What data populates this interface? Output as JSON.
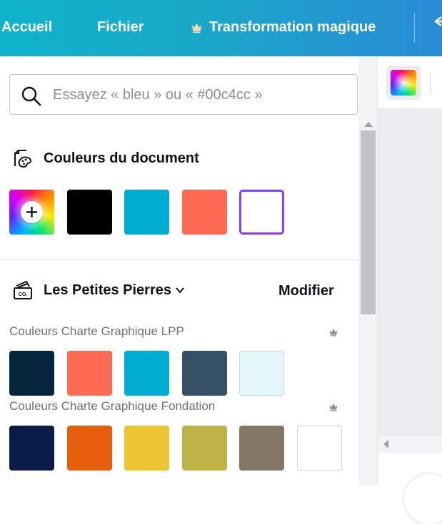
{
  "header": {
    "nav": [
      {
        "label": "Accueil"
      },
      {
        "label": "Fichier"
      },
      {
        "label": "Transformation magique",
        "icon": "crown-icon"
      }
    ],
    "back_icon": "arrow-left-icon"
  },
  "search": {
    "placeholder": "Essayez « bleu » ou « #00c4cc »",
    "value": ""
  },
  "document_colors": {
    "title": "Couleurs du document",
    "icon": "palette-document-icon",
    "swatches": [
      {
        "type": "add-color",
        "icon": "plus-icon"
      },
      {
        "color": "#000000"
      },
      {
        "color": "#00acd1"
      },
      {
        "color": "#ff6a55"
      },
      {
        "color": "#ffffff",
        "selected": true
      }
    ]
  },
  "brand": {
    "name": "Les Petites Pierres",
    "icon": "brand-kit-icon",
    "edit_label": "Modifier",
    "palettes": [
      {
        "label": "Couleurs Charte Graphique LPP",
        "colors": [
          "#05253d",
          "#ff6a55",
          "#00acd1",
          "#365065",
          "#e3f6fa"
        ]
      },
      {
        "label": "Couleurs Charte Graphique Fondation",
        "colors": [
          "#0c1c4a",
          "#e85e0c",
          "#ecc632",
          "#bfb347",
          "#857766",
          "#ffffff"
        ]
      }
    ]
  },
  "colors": {
    "accent": "#8b3dff",
    "header_gradient_start": "#0fb3cc",
    "header_gradient_end": "#2a8bd6"
  }
}
